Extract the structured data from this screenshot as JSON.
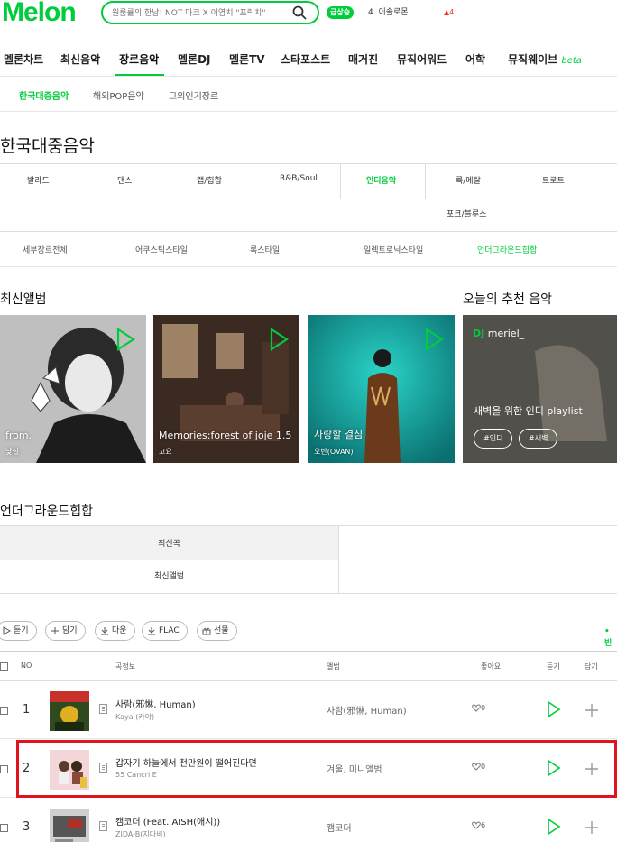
{
  "header": {
    "logo": "Melon",
    "search_placeholder": "원룸률의 한남! NOT 마크 X 이엽치 \"프릭치\"",
    "rise_badge": "급상승",
    "rank_text": "4. 이솔로몬",
    "rank_change": "▲4"
  },
  "gnb": {
    "items": [
      "멜론차트",
      "최신음악",
      "장르음악",
      "멜론DJ",
      "멜론TV",
      "스타포스트",
      "매거진",
      "뮤직어워드",
      "어학",
      "뮤직웨이브"
    ],
    "beta": "beta",
    "active": "장르음악"
  },
  "subnav": [
    "한국대중음악",
    "해외POP음악",
    "그외인기장르"
  ],
  "page_title": "한국대중음악",
  "genres": [
    "발라드",
    "댄스",
    "랩/힙합",
    "R&B/Soul",
    "인디음악",
    "록/메탈",
    "트로트",
    "포크/블루스"
  ],
  "subgenres": [
    "세부장르전체",
    "어쿠스틱스타일",
    "록스타일",
    "일렉트로닉스타일",
    "언더그라운드힙합"
  ],
  "latest_albums_title": "최신앨범",
  "recommend_title": "오늘의 추천 음악",
  "albums": [
    {
      "title": "from.",
      "artist": "낮설"
    },
    {
      "title": "Memories:forest of joje 1.5",
      "artist": "고요"
    },
    {
      "title": "사랑할 결심",
      "artist": "오반(OVAN)"
    }
  ],
  "recommend": {
    "dj_label": "DJ",
    "dj_name": "meriel_",
    "title": "새벽을 위한 인디 playlist",
    "tags": [
      "#인디",
      "#새벽"
    ]
  },
  "section2_title": "언더그라운드힙합",
  "tabs": [
    "최신곡",
    "최신앨범"
  ],
  "buttons": [
    "듣기",
    "담기",
    "다운",
    "FLAC",
    "선물"
  ],
  "right_marker": "• 빈",
  "table": {
    "headers": [
      "NO",
      "곡정보",
      "앨범",
      "좋아요",
      "듣기",
      "담기"
    ],
    "rows": [
      {
        "rank": "1",
        "title": "사람(邪惏, Human)",
        "artist": "Kaya (카야)",
        "album": "사람(邪惏, Human)",
        "likes": "0"
      },
      {
        "rank": "2",
        "title": "갑자기 하늘에서 천만원이 떨어진다면",
        "artist": "55 Cancri E",
        "album": "겨울, 미니앨범",
        "likes": "0"
      },
      {
        "rank": "3",
        "title": "캠코더 (Feat. AISH(애시))",
        "artist": "ZIDA-B(지다비)",
        "album": "캠코더",
        "likes": "6"
      }
    ]
  },
  "colors": {
    "brand": "#00cd3c",
    "highlight": "#e0141e"
  }
}
